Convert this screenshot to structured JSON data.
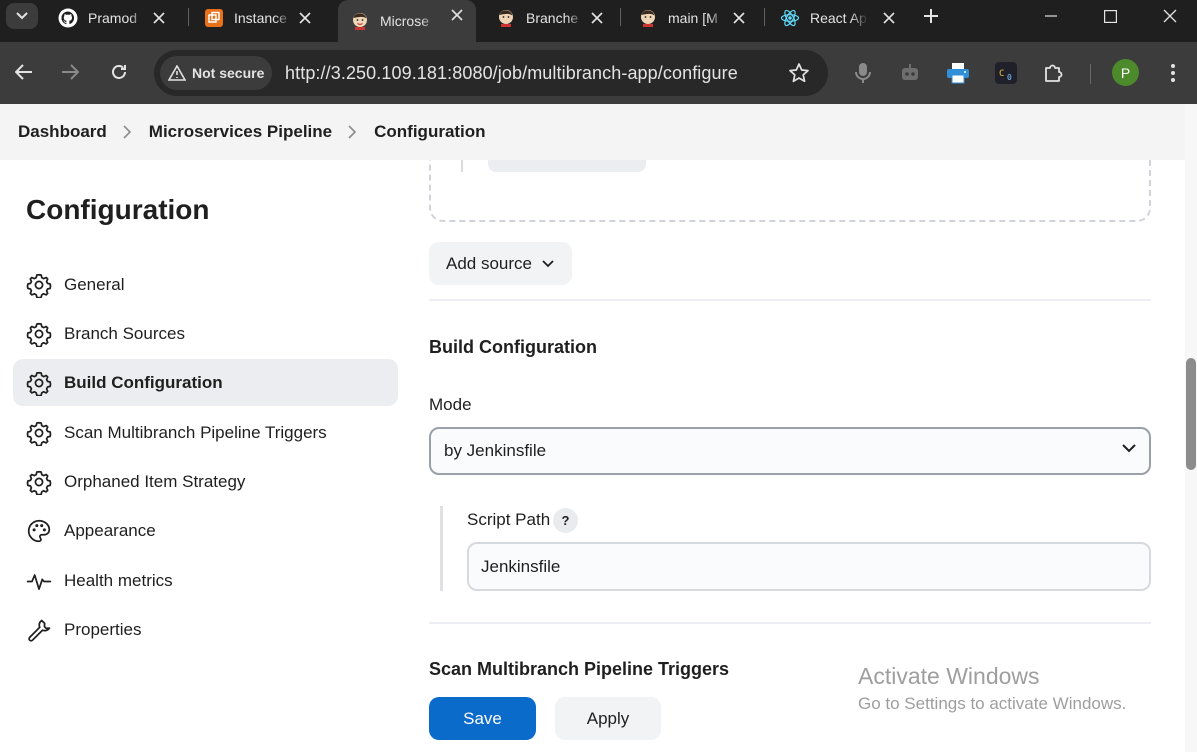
{
  "browser": {
    "tabs": [
      {
        "title": "Pramod",
        "icon": "github-icon",
        "active": false
      },
      {
        "title": "Instance",
        "icon": "aws-icon",
        "active": false
      },
      {
        "title": "Microse",
        "icon": "jenkins-icon",
        "active": true
      },
      {
        "title": "Branche",
        "icon": "jenkins-icon",
        "active": false
      },
      {
        "title": "main [M",
        "icon": "jenkins-icon",
        "active": false
      },
      {
        "title": "React Ap",
        "icon": "react-icon",
        "active": false
      }
    ],
    "security_chip": "Not secure",
    "url": "http://3.250.109.181:8080/job/multibranch-app/configure",
    "profile_initial": "P",
    "profile_color": "#4d8a2b"
  },
  "breadcrumb": {
    "items": [
      "Dashboard",
      "Microservices Pipeline",
      "Configuration"
    ]
  },
  "sidebar": {
    "title": "Configuration",
    "items": [
      {
        "label": "General",
        "icon": "gear-icon"
      },
      {
        "label": "Branch Sources",
        "icon": "gear-icon"
      },
      {
        "label": "Build Configuration",
        "icon": "gear-icon",
        "active": true
      },
      {
        "label": "Scan Multibranch Pipeline Triggers",
        "icon": "gear-icon"
      },
      {
        "label": "Orphaned Item Strategy",
        "icon": "gear-icon"
      },
      {
        "label": "Appearance",
        "icon": "palette-icon"
      },
      {
        "label": "Health metrics",
        "icon": "pulse-icon"
      },
      {
        "label": "Properties",
        "icon": "wrench-icon"
      }
    ]
  },
  "main": {
    "add_source_label": "Add source",
    "build_config": {
      "title": "Build Configuration",
      "mode_label": "Mode",
      "mode_value": "by Jenkinsfile",
      "script_path_label": "Script Path",
      "script_path_help": "?",
      "script_path_value": "Jenkinsfile"
    },
    "next_section_title": "Scan Multibranch Pipeline Triggers",
    "save_label": "Save",
    "apply_label": "Apply"
  },
  "watermark": {
    "line1": "Activate Windows",
    "line2": "Go to Settings to activate Windows."
  },
  "colors": {
    "accent": "#0b6bcb",
    "active_nav_bg": "#ebedf0"
  }
}
